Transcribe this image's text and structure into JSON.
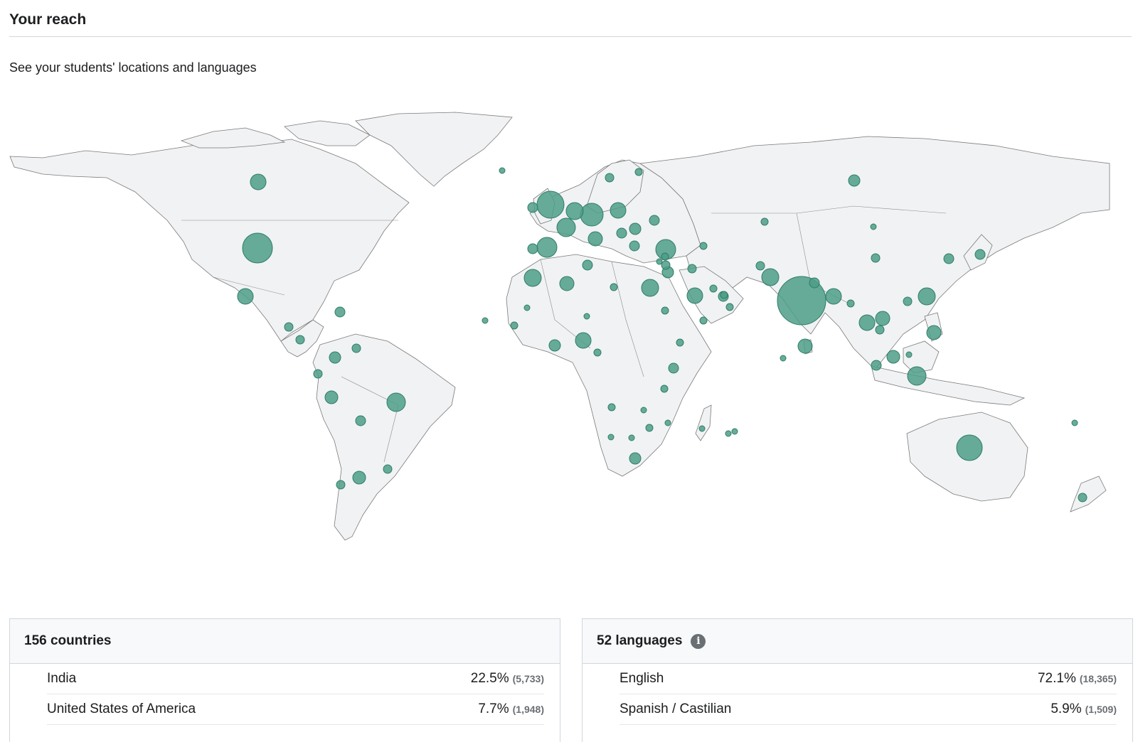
{
  "header": {
    "title": "Your reach"
  },
  "subtitle": "See your students' locations and languages",
  "map": {
    "land_color": "#f1f2f4",
    "bubble_color": "#4e9e87",
    "bubbles_description": "student location bubbles"
  },
  "countries_card": {
    "title": "156 countries",
    "rows": [
      {
        "name": "India",
        "percent": "22.5%",
        "count": "(5,733)"
      },
      {
        "name": "United States of America",
        "percent": "7.7%",
        "count": "(1,948)"
      }
    ]
  },
  "languages_card": {
    "title": "52 languages",
    "info_icon": "info-icon",
    "rows": [
      {
        "name": "English",
        "percent": "72.1%",
        "count": "(18,365)"
      },
      {
        "name": "Spanish / Castilian",
        "percent": "5.9%",
        "count": "(1,509)"
      }
    ]
  }
}
